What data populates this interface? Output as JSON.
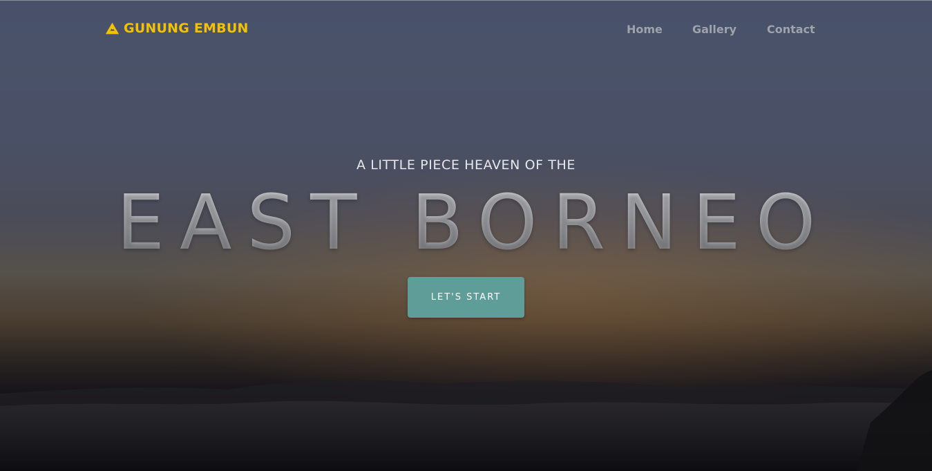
{
  "navbar": {
    "brand_label": "GUNUNG EMBUN",
    "brand_icon": "warning-triangle-icon",
    "links": [
      {
        "label": "Home"
      },
      {
        "label": "Gallery"
      },
      {
        "label": "Contact"
      }
    ]
  },
  "hero": {
    "subtitle": "A LITTLE PIECE HEAVEN OF THE",
    "headline": "EAST BORNEO",
    "cta_label": "LET'S START"
  },
  "colors": {
    "brand": "#f2c200",
    "nav_text": "#9ea3ad",
    "cta_background": "#5f9e98",
    "cta_text": "#ffffff",
    "sky_top": "#475169",
    "horizon_glow": "#55514b",
    "ground": "#0a0a0d"
  }
}
